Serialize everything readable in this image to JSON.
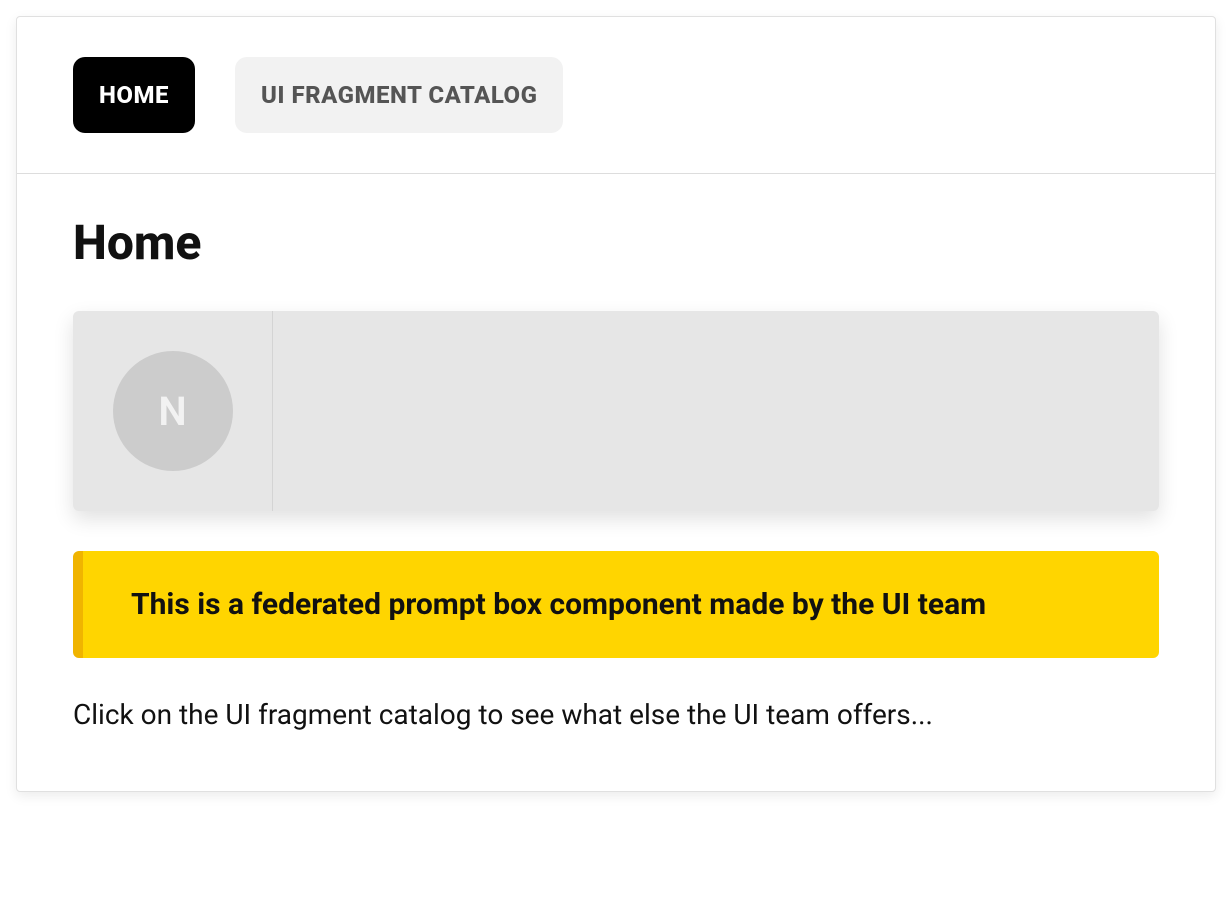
{
  "tabs": {
    "home": "HOME",
    "catalog": "UI FRAGMENT CATALOG"
  },
  "page": {
    "title": "Home"
  },
  "avatar": {
    "initial": "N"
  },
  "banner": {
    "text": "This is a federated prompt box component made by the UI team"
  },
  "hint": "Click on the UI fragment catalog to see what else the UI team offers..."
}
